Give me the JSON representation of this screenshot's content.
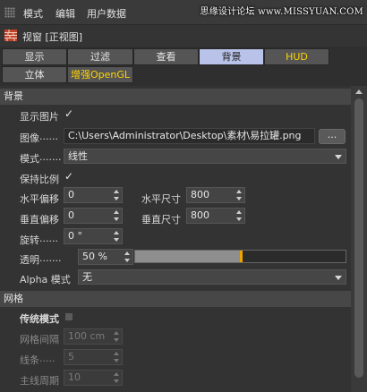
{
  "menubar": {
    "items": [
      "模式",
      "编辑",
      "用户数据"
    ],
    "watermark": "思缘设计论坛 www.MISSYUAN.COM"
  },
  "title": {
    "text": "视窗 [正视图]"
  },
  "tabs": {
    "row1": [
      "显示",
      "过滤",
      "查看",
      "背景",
      "HUD"
    ],
    "row2": [
      "立体",
      "增强OpenGL"
    ],
    "active": "背景"
  },
  "background": {
    "header": "背景",
    "show_image_label": "显示图片",
    "show_image_checked": true,
    "image_label": "图像",
    "image_dots": "......",
    "image_path": "C:\\Users\\Administrator\\Desktop\\素材\\易拉罐.png",
    "browse_label": "...",
    "mode_label": "模式",
    "mode_dots": ".......",
    "mode_value": "线性",
    "keep_ratio_label": "保持比例",
    "keep_ratio_checked": true,
    "h_offset_label": "水平偏移",
    "h_offset_value": "0",
    "h_size_label": "水平尺寸",
    "h_size_value": "800",
    "v_offset_label": "垂直偏移",
    "v_offset_value": "0",
    "v_size_label": "垂直尺寸",
    "v_size_value": "800",
    "rotate_label": "旋转",
    "rotate_dots": "......",
    "rotate_value": "0 °",
    "transparency_label": "透明",
    "transparency_dots": ".......",
    "transparency_value": "50 %",
    "transparency_fraction": 0.5,
    "alpha_label": "Alpha 模式",
    "alpha_value": "无"
  },
  "grid": {
    "header": "网格",
    "legacy_label": "传统模式",
    "legacy_checked": false,
    "spacing_label": "网格间隔",
    "spacing_value": "100 cm",
    "lines_label": "线条",
    "lines_dots": ".....",
    "lines_value": "5",
    "major_label": "主线周期",
    "major_value": "10"
  },
  "colors": {
    "active_tab": "#b9c3e9",
    "highlight_text": "#ffd400",
    "slider_knob": "#f0a400"
  }
}
